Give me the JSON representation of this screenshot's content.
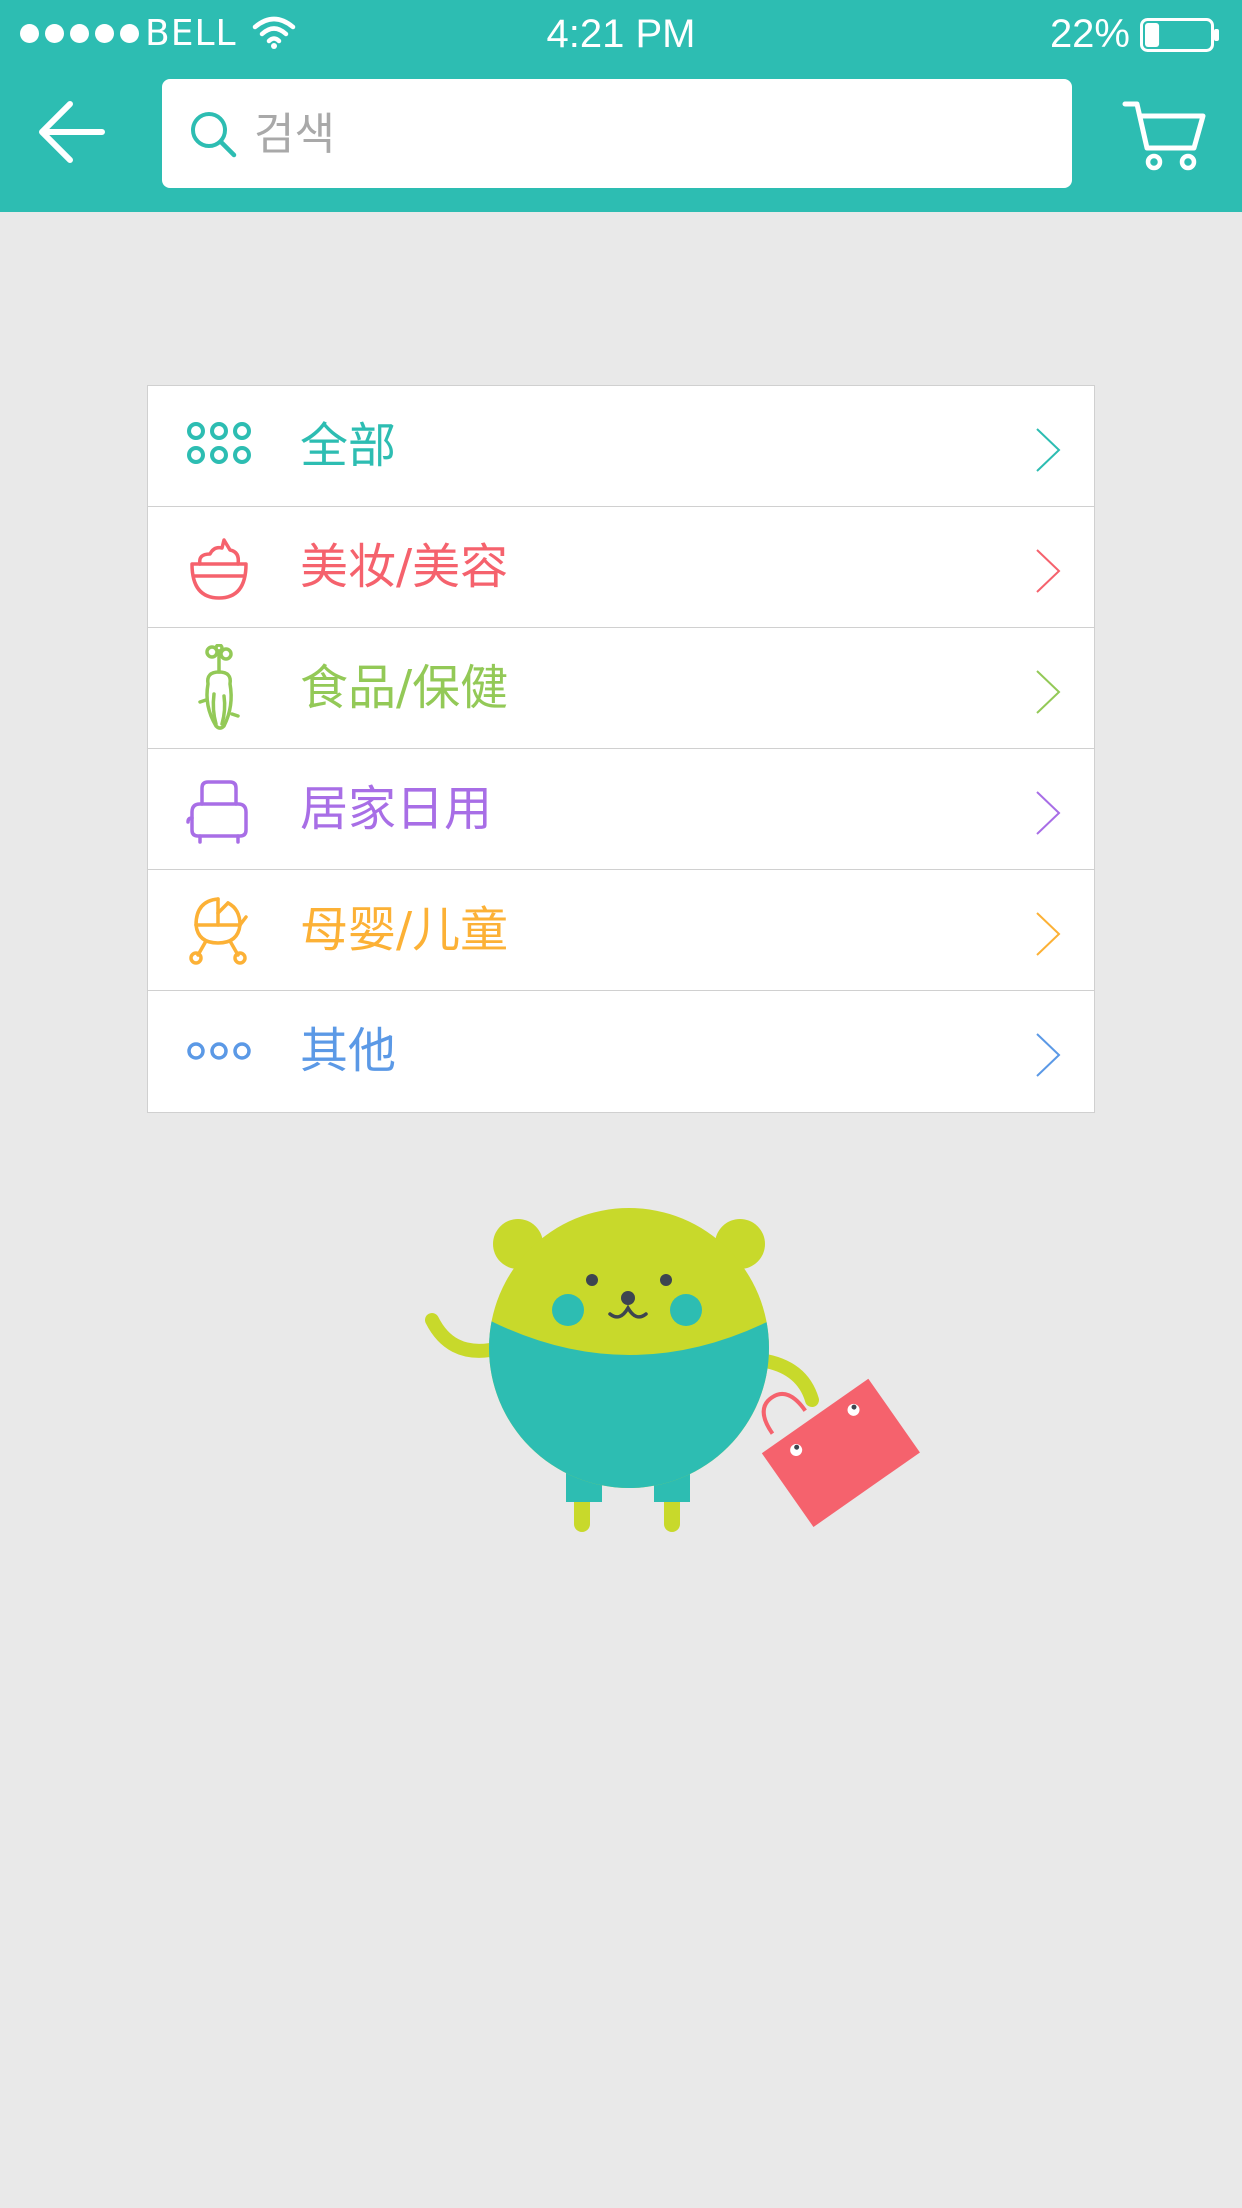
{
  "status_bar": {
    "carrier": "BELL",
    "time": "4:21 PM",
    "battery_percent": "22%",
    "battery_level": 0.22,
    "signal_dots": 5
  },
  "nav": {
    "back_icon": "arrow-left-icon",
    "search_placeholder": "검색",
    "search_value": "",
    "search_icon": "search-icon",
    "cart_icon": "cart-icon"
  },
  "colors": {
    "header": "#2dbdb2",
    "background": "#e9e9e9",
    "all": "#2dbdb2",
    "beauty": "#f5626d",
    "food": "#93c957",
    "home": "#a86ee6",
    "baby": "#fcb136",
    "other": "#5b99e6"
  },
  "categories": [
    {
      "label": "全部",
      "icon": "grid-dots-icon",
      "color": "#2dbdb2"
    },
    {
      "label": "美妆/美容",
      "icon": "cosmetic-jar-icon",
      "color": "#f5626d"
    },
    {
      "label": "食品/保健",
      "icon": "carrot-icon",
      "color": "#93c957"
    },
    {
      "label": "居家日用",
      "icon": "toaster-icon",
      "color": "#a86ee6"
    },
    {
      "label": "母婴/儿童",
      "icon": "stroller-icon",
      "color": "#fcb136"
    },
    {
      "label": "其他",
      "icon": "more-dots-icon",
      "color": "#5b99e6"
    }
  ],
  "mascot": {
    "name": "bear-mascot-illustration"
  }
}
